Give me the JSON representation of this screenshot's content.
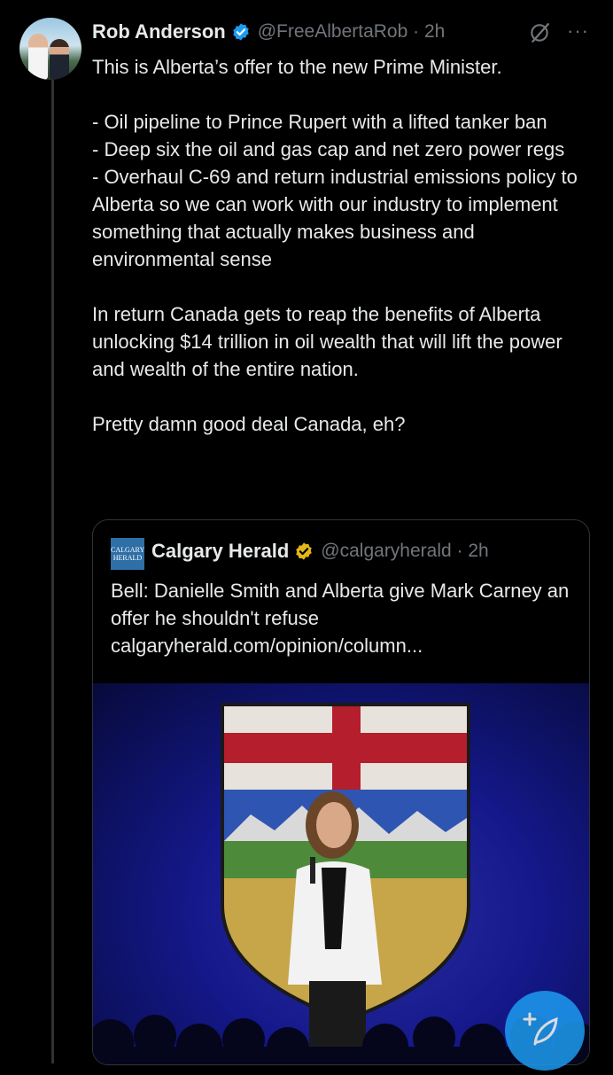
{
  "tweet": {
    "author_name": "Rob Anderson",
    "handle_time": "@FreeAlbertaRob · 2h",
    "more_label": "···",
    "text": "This is Alberta’s offer to the new Prime Minister.\n\n- Oil pipeline to Prince Rupert with a lifted tanker ban\n- Deep six the oil and gas cap and net zero power regs\n- Overhaul C-69 and return industrial emissions policy to Alberta so we can work with our industry to implement something that actually makes business and environmental sense\n\nIn return Canada gets to reap the benefits of Alberta unlocking $14 trillion in oil wealth that will lift the power and wealth of the entire nation.\n\nPretty damn good deal Canada, eh?"
  },
  "quoted_tweet": {
    "logo_text_line1": "CALGARY",
    "logo_text_line2": "HERALD",
    "author_name": "Calgary Herald",
    "handle_time": "@calgaryherald · 2h",
    "text": "Bell: Danielle Smith and Alberta give Mark Carney an offer he shouldn't refuse\ncalgaryherald.com/opinion/column..."
  },
  "icons": {
    "verified": "verified-badge-blue",
    "verified_org": "verified-badge-gold",
    "grok": "grok-icon",
    "more": "more-icon",
    "compose": "compose-icon"
  },
  "colors": {
    "background": "#000000",
    "text": "#e7e9ea",
    "muted": "#71767b",
    "accent": "#1d9bf0",
    "gold": "#e2b719"
  }
}
